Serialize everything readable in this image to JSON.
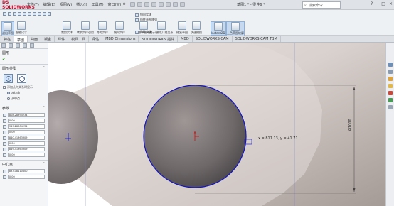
{
  "app": {
    "logo_text": "DS SOLIDWORKS",
    "menus": [
      "文件(F)",
      "编辑(E)",
      "视图(V)",
      "插入(I)",
      "工具(T)",
      "窗口(W)"
    ],
    "doc_title": "草图1 * - 零件6 *",
    "search_placeholder": "搜索命令",
    "window_controls": [
      "?",
      "-",
      "□",
      "×"
    ]
  },
  "ribbon": {
    "big_buttons": [
      {
        "label": "退出草图",
        "active": true
      },
      {
        "label": "智能尺寸",
        "active": false
      },
      {
        "label": "裁剪实体",
        "active": false
      },
      {
        "label": "转换实体引用",
        "active": false
      },
      {
        "label": "等距实体",
        "active": false
      },
      {
        "label": "镜向实体",
        "active": false
      },
      {
        "label": "线性草图阵列",
        "active": false
      },
      {
        "label": "显示/删除几何关系",
        "active": false
      },
      {
        "label": "修复草图",
        "active": false
      },
      {
        "label": "快速捕捉",
        "active": false
      },
      {
        "label": "Instant2D",
        "active": true
      },
      {
        "label": "上色草图轮廓",
        "active": true
      }
    ],
    "small_buttons": [
      "镜向实体",
      "线性草图阵列",
      "移动实体"
    ]
  },
  "tabs": [
    {
      "label": "特征",
      "active": false
    },
    {
      "label": "草图",
      "active": true
    },
    {
      "label": "曲面",
      "active": false
    },
    {
      "label": "钣金",
      "active": false
    },
    {
      "label": "焊件",
      "active": false
    },
    {
      "label": "模具工具",
      "active": false
    },
    {
      "label": "评估",
      "active": false
    },
    {
      "label": "MBD Dimensions",
      "active": false
    },
    {
      "label": "SOLIDWORKS 插件",
      "active": false
    },
    {
      "label": "MBD",
      "active": false
    },
    {
      "label": "SOLIDWORKS CAM",
      "active": false
    },
    {
      "label": "SOLIDWORKS CAM TBM",
      "active": false
    }
  ],
  "property_manager": {
    "title": "圆形",
    "section_type": "圆形类型",
    "checkbox_label": "添加几何关系时显示",
    "radio_options": [
      {
        "label": "从边角",
        "checked": true
      },
      {
        "label": "从中点",
        "checked": false
      }
    ],
    "params_title": "参数",
    "params": [
      "808.28394234",
      "0.00",
      "349.28304234",
      "0.00",
      "840.41363309",
      "0.00",
      "849.41363309",
      "0.00"
    ],
    "center_title": "中心点",
    "center_params": [
      "833.08110600",
      "0.00"
    ]
  },
  "sketch": {
    "dimension_label": "Ø1000",
    "coordinate_readout": "x = 811.13, y = 41.71"
  },
  "colors": {
    "sketch_blue": "#1515c4",
    "origin_red": "#d51616",
    "accent": "#c8102e"
  }
}
